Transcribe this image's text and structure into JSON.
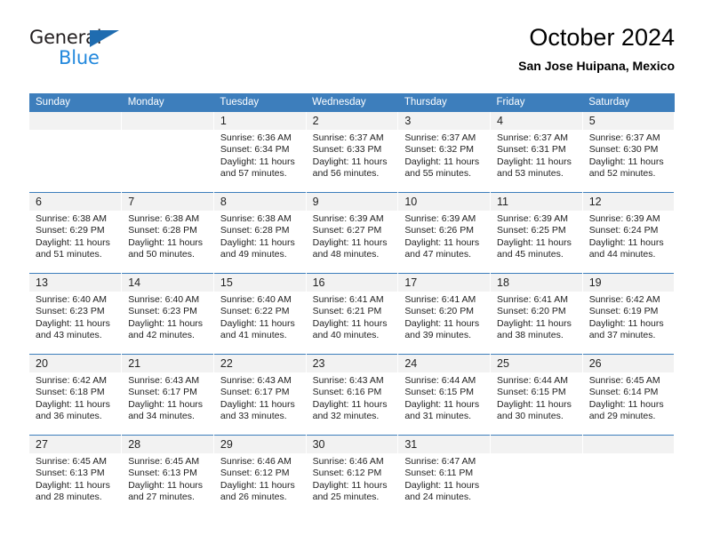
{
  "brand": {
    "name_top": "General",
    "name_bottom": "Blue",
    "triangle_color": "#1f6cb0",
    "blue_color": "#2288dd"
  },
  "header": {
    "title": "October 2024",
    "subtitle": "San Jose Huipana, Mexico"
  },
  "colors": {
    "header_row": "#3d7ebc",
    "daynum_band": "#f2f2f2",
    "text": "#222222"
  },
  "weekday_headers": [
    "Sunday",
    "Monday",
    "Tuesday",
    "Wednesday",
    "Thursday",
    "Friday",
    "Saturday"
  ],
  "weeks": [
    [
      {
        "day": "",
        "lines": []
      },
      {
        "day": "",
        "lines": []
      },
      {
        "day": "1",
        "lines": [
          "Sunrise: 6:36 AM",
          "Sunset: 6:34 PM",
          "Daylight: 11 hours",
          "and 57 minutes."
        ]
      },
      {
        "day": "2",
        "lines": [
          "Sunrise: 6:37 AM",
          "Sunset: 6:33 PM",
          "Daylight: 11 hours",
          "and 56 minutes."
        ]
      },
      {
        "day": "3",
        "lines": [
          "Sunrise: 6:37 AM",
          "Sunset: 6:32 PM",
          "Daylight: 11 hours",
          "and 55 minutes."
        ]
      },
      {
        "day": "4",
        "lines": [
          "Sunrise: 6:37 AM",
          "Sunset: 6:31 PM",
          "Daylight: 11 hours",
          "and 53 minutes."
        ]
      },
      {
        "day": "5",
        "lines": [
          "Sunrise: 6:37 AM",
          "Sunset: 6:30 PM",
          "Daylight: 11 hours",
          "and 52 minutes."
        ]
      }
    ],
    [
      {
        "day": "6",
        "lines": [
          "Sunrise: 6:38 AM",
          "Sunset: 6:29 PM",
          "Daylight: 11 hours",
          "and 51 minutes."
        ]
      },
      {
        "day": "7",
        "lines": [
          "Sunrise: 6:38 AM",
          "Sunset: 6:28 PM",
          "Daylight: 11 hours",
          "and 50 minutes."
        ]
      },
      {
        "day": "8",
        "lines": [
          "Sunrise: 6:38 AM",
          "Sunset: 6:28 PM",
          "Daylight: 11 hours",
          "and 49 minutes."
        ]
      },
      {
        "day": "9",
        "lines": [
          "Sunrise: 6:39 AM",
          "Sunset: 6:27 PM",
          "Daylight: 11 hours",
          "and 48 minutes."
        ]
      },
      {
        "day": "10",
        "lines": [
          "Sunrise: 6:39 AM",
          "Sunset: 6:26 PM",
          "Daylight: 11 hours",
          "and 47 minutes."
        ]
      },
      {
        "day": "11",
        "lines": [
          "Sunrise: 6:39 AM",
          "Sunset: 6:25 PM",
          "Daylight: 11 hours",
          "and 45 minutes."
        ]
      },
      {
        "day": "12",
        "lines": [
          "Sunrise: 6:39 AM",
          "Sunset: 6:24 PM",
          "Daylight: 11 hours",
          "and 44 minutes."
        ]
      }
    ],
    [
      {
        "day": "13",
        "lines": [
          "Sunrise: 6:40 AM",
          "Sunset: 6:23 PM",
          "Daylight: 11 hours",
          "and 43 minutes."
        ]
      },
      {
        "day": "14",
        "lines": [
          "Sunrise: 6:40 AM",
          "Sunset: 6:23 PM",
          "Daylight: 11 hours",
          "and 42 minutes."
        ]
      },
      {
        "day": "15",
        "lines": [
          "Sunrise: 6:40 AM",
          "Sunset: 6:22 PM",
          "Daylight: 11 hours",
          "and 41 minutes."
        ]
      },
      {
        "day": "16",
        "lines": [
          "Sunrise: 6:41 AM",
          "Sunset: 6:21 PM",
          "Daylight: 11 hours",
          "and 40 minutes."
        ]
      },
      {
        "day": "17",
        "lines": [
          "Sunrise: 6:41 AM",
          "Sunset: 6:20 PM",
          "Daylight: 11 hours",
          "and 39 minutes."
        ]
      },
      {
        "day": "18",
        "lines": [
          "Sunrise: 6:41 AM",
          "Sunset: 6:20 PM",
          "Daylight: 11 hours",
          "and 38 minutes."
        ]
      },
      {
        "day": "19",
        "lines": [
          "Sunrise: 6:42 AM",
          "Sunset: 6:19 PM",
          "Daylight: 11 hours",
          "and 37 minutes."
        ]
      }
    ],
    [
      {
        "day": "20",
        "lines": [
          "Sunrise: 6:42 AM",
          "Sunset: 6:18 PM",
          "Daylight: 11 hours",
          "and 36 minutes."
        ]
      },
      {
        "day": "21",
        "lines": [
          "Sunrise: 6:43 AM",
          "Sunset: 6:17 PM",
          "Daylight: 11 hours",
          "and 34 minutes."
        ]
      },
      {
        "day": "22",
        "lines": [
          "Sunrise: 6:43 AM",
          "Sunset: 6:17 PM",
          "Daylight: 11 hours",
          "and 33 minutes."
        ]
      },
      {
        "day": "23",
        "lines": [
          "Sunrise: 6:43 AM",
          "Sunset: 6:16 PM",
          "Daylight: 11 hours",
          "and 32 minutes."
        ]
      },
      {
        "day": "24",
        "lines": [
          "Sunrise: 6:44 AM",
          "Sunset: 6:15 PM",
          "Daylight: 11 hours",
          "and 31 minutes."
        ]
      },
      {
        "day": "25",
        "lines": [
          "Sunrise: 6:44 AM",
          "Sunset: 6:15 PM",
          "Daylight: 11 hours",
          "and 30 minutes."
        ]
      },
      {
        "day": "26",
        "lines": [
          "Sunrise: 6:45 AM",
          "Sunset: 6:14 PM",
          "Daylight: 11 hours",
          "and 29 minutes."
        ]
      }
    ],
    [
      {
        "day": "27",
        "lines": [
          "Sunrise: 6:45 AM",
          "Sunset: 6:13 PM",
          "Daylight: 11 hours",
          "and 28 minutes."
        ]
      },
      {
        "day": "28",
        "lines": [
          "Sunrise: 6:45 AM",
          "Sunset: 6:13 PM",
          "Daylight: 11 hours",
          "and 27 minutes."
        ]
      },
      {
        "day": "29",
        "lines": [
          "Sunrise: 6:46 AM",
          "Sunset: 6:12 PM",
          "Daylight: 11 hours",
          "and 26 minutes."
        ]
      },
      {
        "day": "30",
        "lines": [
          "Sunrise: 6:46 AM",
          "Sunset: 6:12 PM",
          "Daylight: 11 hours",
          "and 25 minutes."
        ]
      },
      {
        "day": "31",
        "lines": [
          "Sunrise: 6:47 AM",
          "Sunset: 6:11 PM",
          "Daylight: 11 hours",
          "and 24 minutes."
        ]
      },
      {
        "day": "",
        "lines": []
      },
      {
        "day": "",
        "lines": []
      }
    ]
  ]
}
